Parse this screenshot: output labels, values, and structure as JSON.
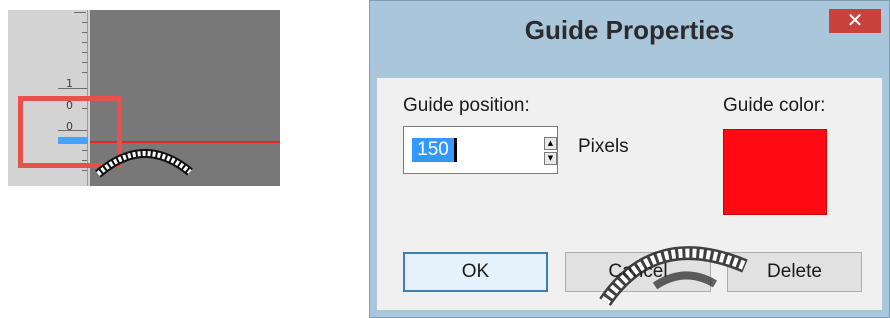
{
  "ruler": {
    "labels": [
      "1",
      "0",
      "0"
    ],
    "guide_marker_color": "#45a2ff",
    "guide_line_color": "#e8262a",
    "highlight_color": "#e8504c"
  },
  "dialog": {
    "title": "Guide Properties",
    "close_glyph": "✕",
    "guide_position_label": "Guide position:",
    "guide_position_value": "150",
    "unit_label": "Pixels",
    "guide_color_label": "Guide color:",
    "guide_color": "#ff0a14",
    "buttons": {
      "ok": "OK",
      "cancel": "Cancel",
      "delete": "Delete"
    },
    "icons": {
      "spin_up": "up-arrow-icon",
      "spin_down": "down-arrow-icon",
      "close": "close-icon"
    }
  }
}
